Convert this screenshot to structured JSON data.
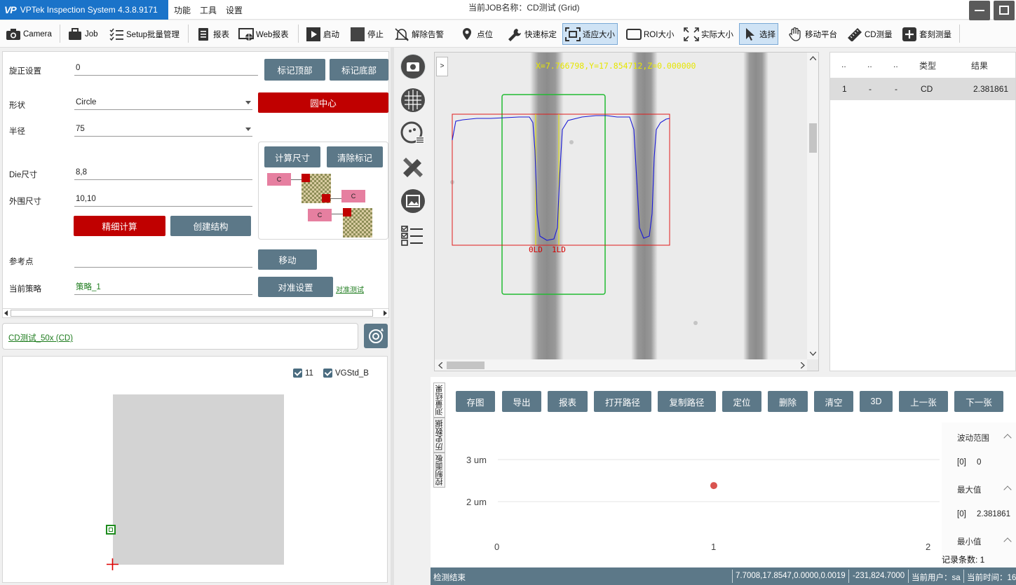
{
  "app": {
    "title": "VPTek Inspection System 4.3.8.9171",
    "logo": "VP",
    "brand_color": "#1a73c9",
    "menu": [
      "功能",
      "工具",
      "设置"
    ],
    "job_title": "当前JOB名称：CD测试 (Grid)"
  },
  "toolbar": {
    "items": [
      {
        "label": "Camera",
        "icon": "camera-icon"
      },
      {
        "label": "Job",
        "icon": "briefcase-icon"
      },
      {
        "label": "Setup批量管理",
        "icon": "checklist-icon"
      },
      {
        "label": "报表",
        "icon": "report-icon"
      },
      {
        "label": "Web报表",
        "icon": "web-report-icon"
      },
      {
        "label": "启动",
        "icon": "play-icon"
      },
      {
        "label": "停止",
        "icon": "stop-icon"
      },
      {
        "label": "解除告警",
        "icon": "bell-off-icon"
      },
      {
        "label": "点位",
        "icon": "pin-icon"
      },
      {
        "label": "快速标定",
        "icon": "wrench-icon"
      },
      {
        "label": "适应大小",
        "icon": "fit-icon"
      },
      {
        "label": "ROI大小",
        "icon": "rect-icon"
      },
      {
        "label": "实际大小",
        "icon": "expand-icon"
      },
      {
        "label": "选择",
        "icon": "cursor-icon"
      },
      {
        "label": "移动平台",
        "icon": "hand-icon"
      },
      {
        "label": "CD测量",
        "icon": "ruler-icon"
      },
      {
        "label": "套刻测量",
        "icon": "plus-icon"
      }
    ],
    "active": [
      "适应大小",
      "选择"
    ]
  },
  "left_panel": {
    "rotation_label": "旋正设置",
    "rotation_value": "0",
    "mark_top": "标记顶部",
    "mark_bottom": "标记底部",
    "shape_label": "形状",
    "shape_value": "Circle",
    "circle_center": "圆中心",
    "radius_label": "半径",
    "radius_value": "75",
    "calc_size": "计算尺寸",
    "clear_marks": "清除标记",
    "die_label": "Die尺寸",
    "die_value": "8,8",
    "outer_label": "外围尺寸",
    "outer_value": "10,10",
    "fine_calc": "精细计算",
    "create_struct": "创建结构",
    "ref_label": "参考点",
    "ref_value": "",
    "move": "移动",
    "strategy_label": "当前策略",
    "strategy_value": "策略_1",
    "align_settings": "对准设置",
    "align_test": "对准测试",
    "schematic_label": "C"
  },
  "strategy_link": "CD测试_50x (CD)",
  "preview": {
    "checks": [
      {
        "label": "11",
        "checked": true
      },
      {
        "label": "VGStd_B",
        "checked": true
      }
    ]
  },
  "viewer": {
    "coords": "X=7.766798,Y=17.854712,Z=0.000000",
    "expand_label": ">",
    "labels": [
      "0LD",
      "1LD"
    ]
  },
  "result_table": {
    "headers": [
      "..",
      "..",
      "..",
      "类型",
      "结果"
    ],
    "rows": [
      {
        "c1": "1",
        "c2": "-",
        "c3": "-",
        "type": "CD",
        "result": "2.381861"
      }
    ]
  },
  "results": {
    "side_tabs": [
      "测量结果",
      "历史数据",
      "控制面板"
    ],
    "buttons": [
      "存图",
      "导出",
      "报表",
      "打开路径",
      "复制路径",
      "定位",
      "删除",
      "清空",
      "3D",
      "上一张",
      "下一张"
    ],
    "stats": [
      {
        "label": "波动范围",
        "index": "[0]",
        "value": "0"
      },
      {
        "label": "最大值",
        "index": "[0]",
        "value": "2.381861"
      },
      {
        "label": "最小值",
        "index": "",
        "value": ""
      }
    ],
    "record_count": "记录条数: 1"
  },
  "chart_data": {
    "type": "scatter",
    "x": [
      1
    ],
    "y": [
      2.381861
    ],
    "ytick_labels": [
      "3 um",
      "2 um"
    ],
    "xtick_labels": [
      "0",
      "1",
      "2"
    ],
    "xlim": [
      0,
      2
    ],
    "ylim_visible": [
      1.8,
      3.2
    ],
    "point_color": "#d9534f",
    "grid": true
  },
  "statusbar": {
    "state": "检测结束",
    "position": "7.7008,17.8547,0.0000,0.0019",
    "offset": "-231,824.7000",
    "user": "当前用户：sa",
    "time": "当前时间：16"
  }
}
